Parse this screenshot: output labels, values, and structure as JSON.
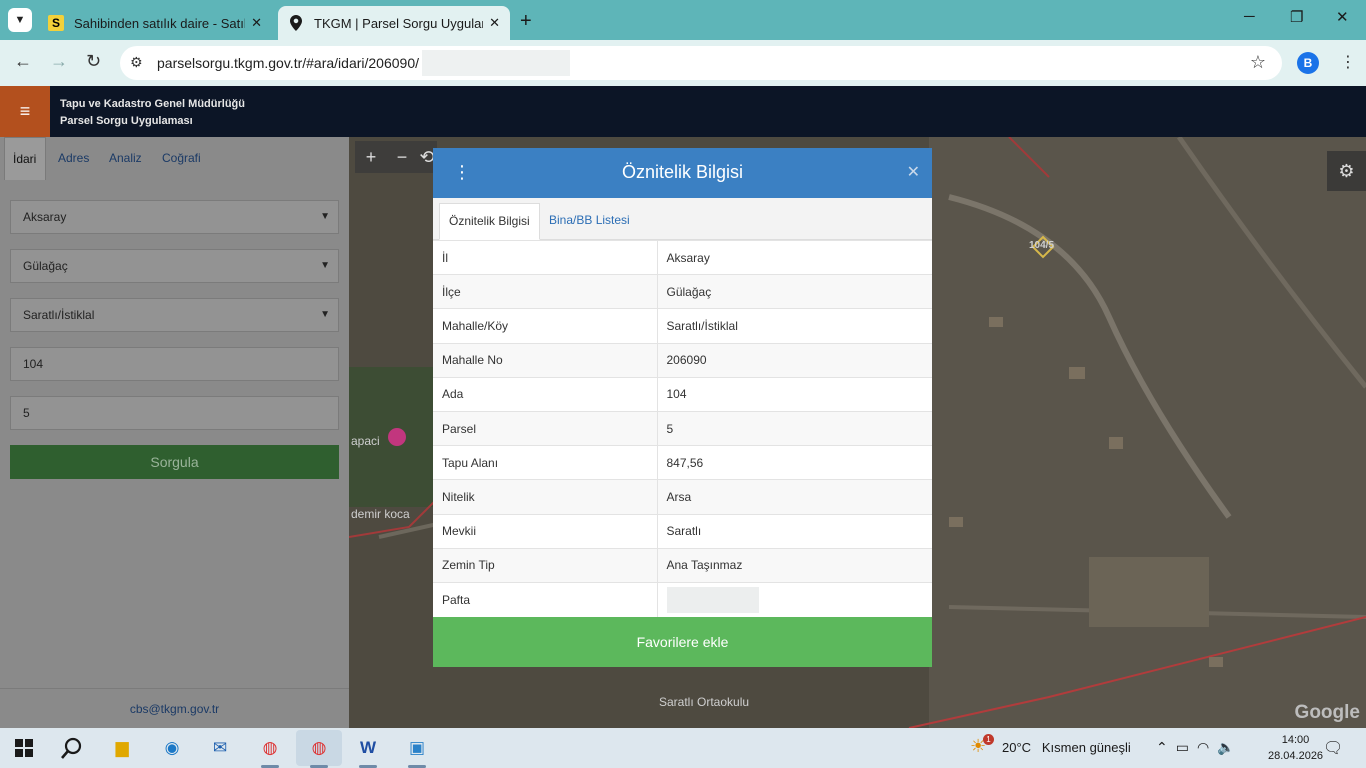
{
  "browser": {
    "tabs": [
      {
        "favicon": "S",
        "title": "Sahibinden satılık daire - Satılık",
        "close": "✕"
      },
      {
        "favicon": "location-pin-icon",
        "title": "TKGM | Parsel Sorgu Uygulaması",
        "close": "✕"
      }
    ],
    "new_tab": "+",
    "url": "parselsorgu.tkgm.gov.tr/#ara/idari/206090/",
    "profile_initial": "B"
  },
  "app": {
    "org_line1": "Tapu ve Kadastro Genel Müdürlüğü",
    "org_line2": "Parsel Sorgu Uygulaması"
  },
  "panel": {
    "tabs": [
      "İdari",
      "Adres",
      "Analiz",
      "Coğrafi"
    ],
    "il": "Aksaray",
    "ilce": "Gülağaç",
    "mahalle": "Saratlı/İstiklal",
    "ada": "104",
    "parsel": "5",
    "submit_label": "Sorgula",
    "footer_email": "cbs@tkgm.gov.tr"
  },
  "map": {
    "labels": [
      "104/5",
      "apaci",
      "demir koca",
      "Saratlı Ortaokulu"
    ],
    "attribution": "Google",
    "zoom_in": "+",
    "zoom_out": "−"
  },
  "modal": {
    "title": "Öznitelik Bilgisi",
    "close": "✕",
    "tabs": [
      "Öznitelik Bilgisi",
      "Bina/BB Listesi"
    ],
    "rows": [
      {
        "key": "İl",
        "value": "Aksaray"
      },
      {
        "key": "İlçe",
        "value": "Gülağaç"
      },
      {
        "key": "Mahalle/Köy",
        "value": "Saratlı/İstiklal"
      },
      {
        "key": "Mahalle No",
        "value": "206090"
      },
      {
        "key": "Ada",
        "value": "104"
      },
      {
        "key": "Parsel",
        "value": "5"
      },
      {
        "key": "Tapu Alanı",
        "value": "847,56"
      },
      {
        "key": "Nitelik",
        "value": "Arsa"
      },
      {
        "key": "Mevkii",
        "value": "Saratlı"
      },
      {
        "key": "Zemin Tip",
        "value": "Ana Taşınmaz"
      },
      {
        "key": "Pafta",
        "value": ""
      }
    ],
    "favorite_label": "Favorilere ekle"
  },
  "taskbar": {
    "weather_temp": "20°C",
    "weather_desc": "Kısmen güneşli",
    "weather_badge": "1",
    "time": "14:00",
    "date": "28.04.2026"
  },
  "colors": {
    "tabbar": "#5eb5b8",
    "header": "#0c1526",
    "hamburger": "#b3501e",
    "modal_header": "#3b80c3",
    "favorite_button": "#5cb85c"
  }
}
